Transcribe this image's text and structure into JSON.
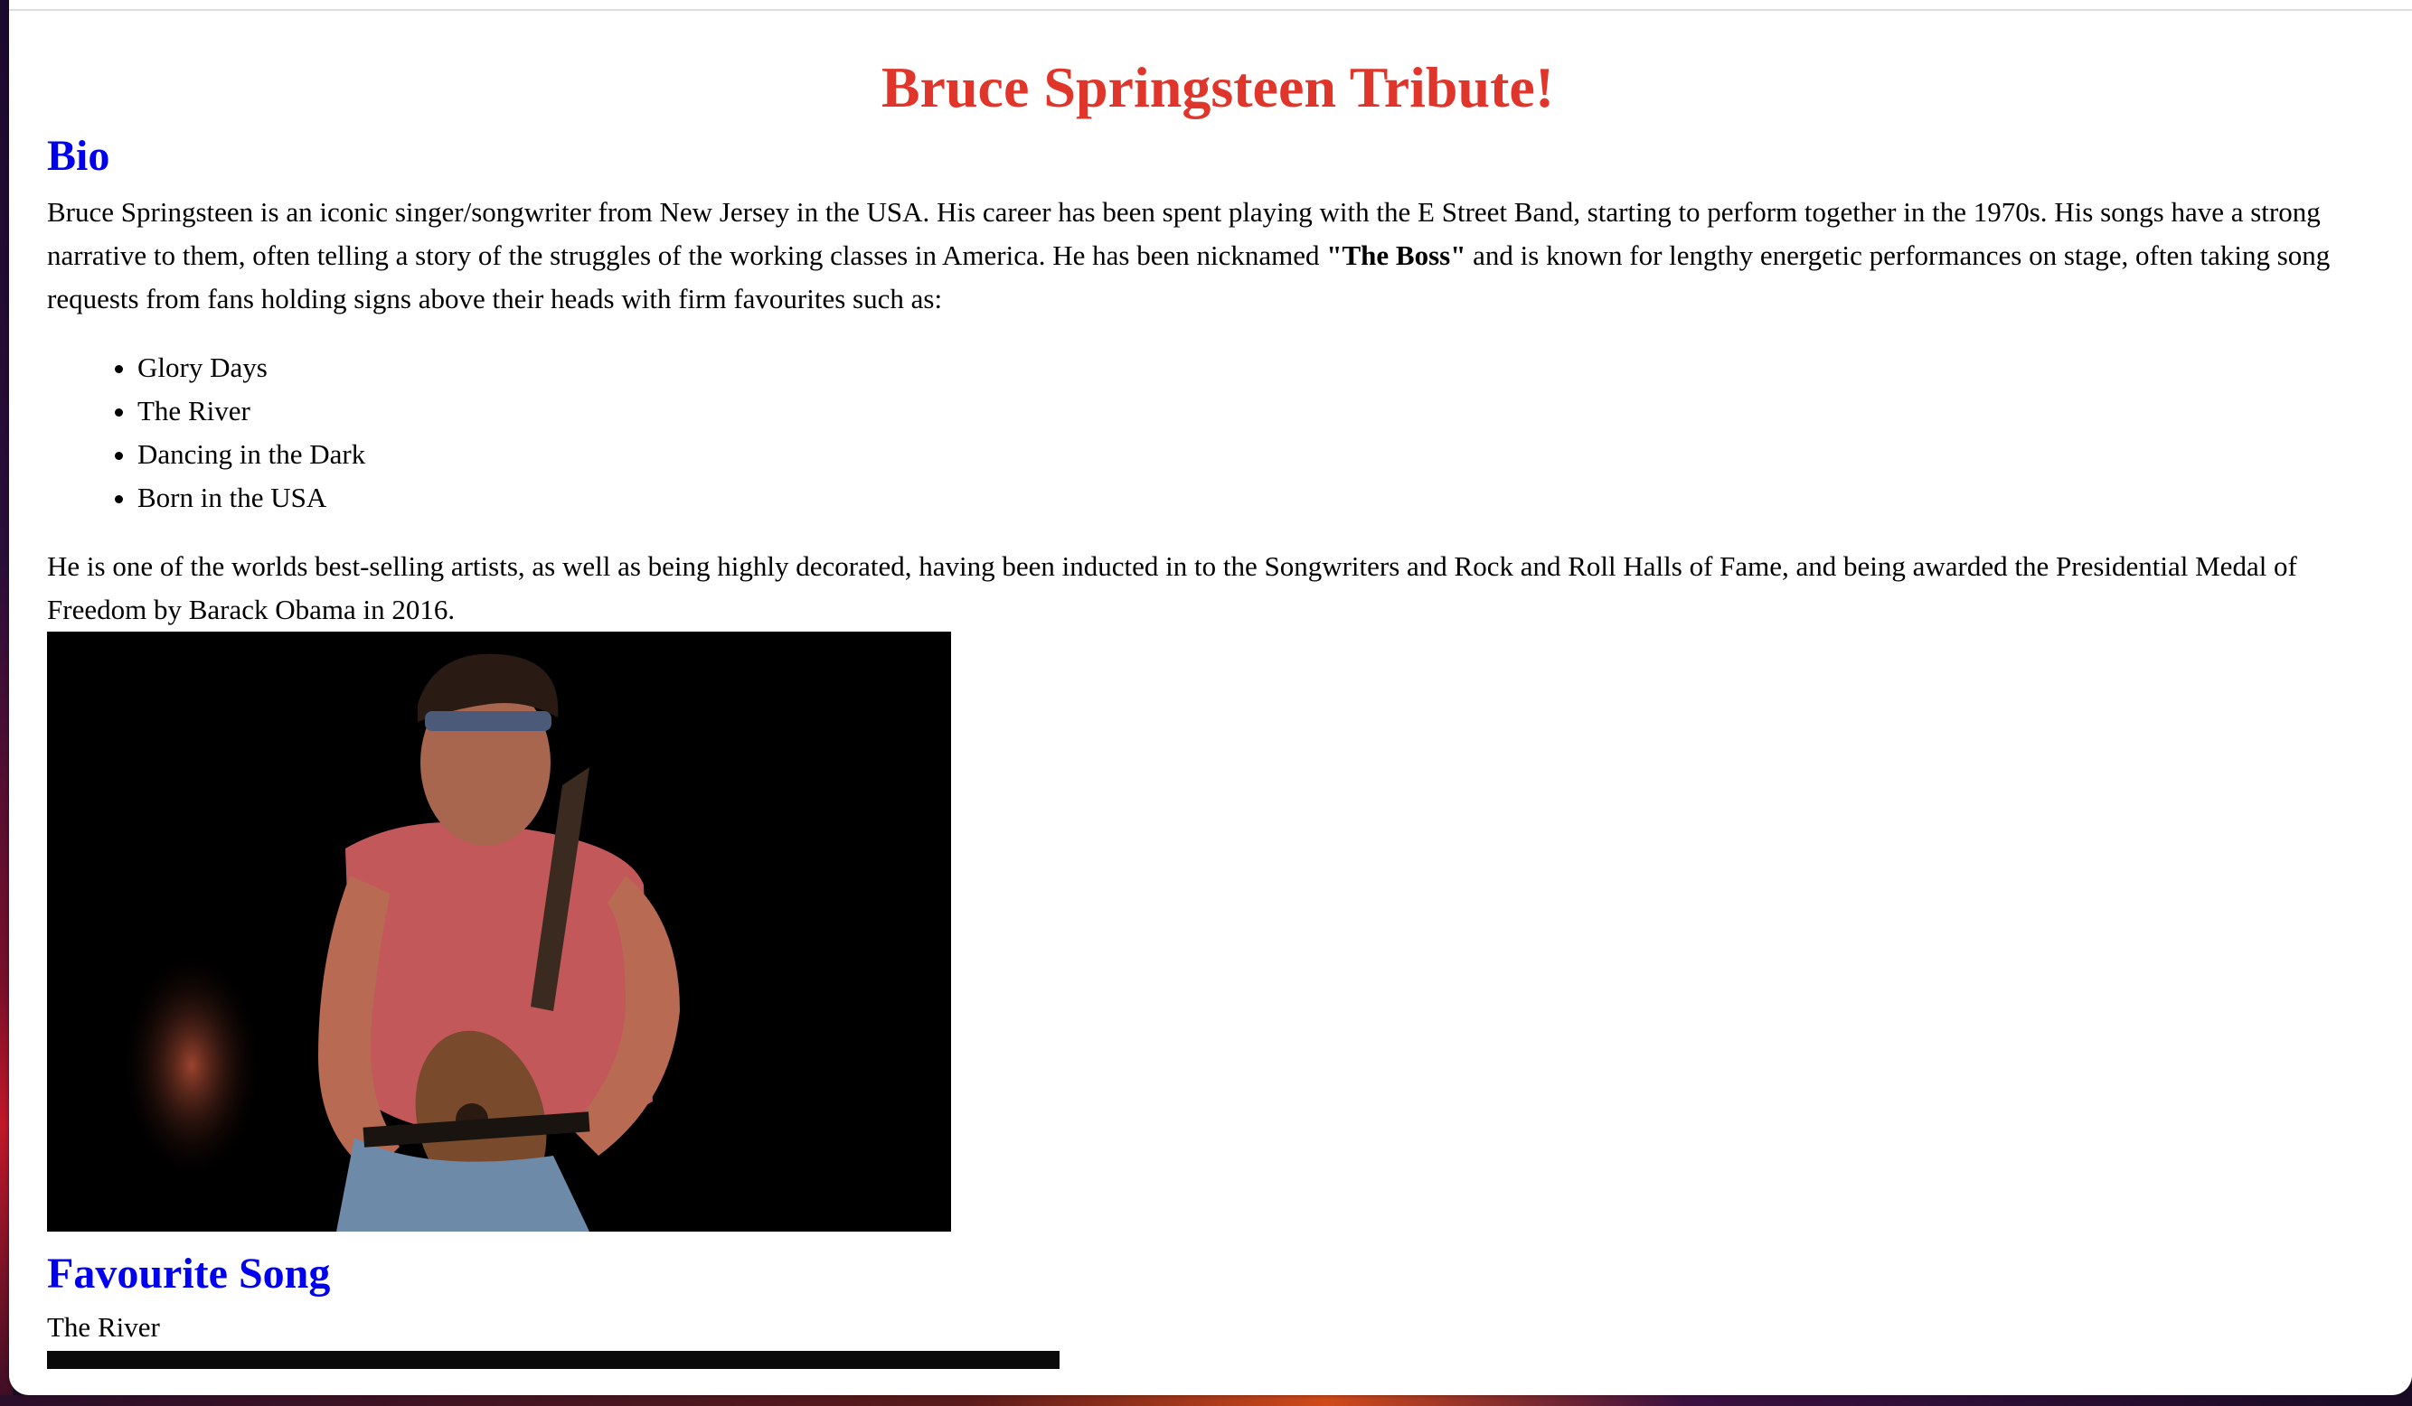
{
  "page": {
    "title": "Bruce Springsteen Tribute!"
  },
  "bio": {
    "heading": "Bio",
    "intro_part1": "Bruce Springsteen is an iconic singer/songwriter from New Jersey in the USA. His career has been spent playing with the E Street Band, starting to perform together in the 1970s. His songs have a strong narrative to them, often telling a story of the struggles of the working classes in America. He has been nicknamed ",
    "nickname": "\"The Boss\"",
    "intro_part2": " and is known for lengthy energetic performances on stage, often taking song requests from fans holding signs above their heads with firm favourites such as:",
    "songs": [
      "Glory Days",
      "The River",
      "Dancing in the Dark",
      "Born in the USA"
    ],
    "closing": "He is one of the worlds best-selling artists, as well as being highly decorated, having been inducted in to the Songwriters and Rock and Roll Halls of Fame, and being awarded the Presidential Medal of Freedom by Barack Obama in 2016."
  },
  "favourite": {
    "heading": "Favourite Song",
    "song": "The River"
  },
  "colors": {
    "title": "#e0352b",
    "heading": "#0000ee"
  },
  "icons": {
    "photo": "guitarist-photo"
  }
}
